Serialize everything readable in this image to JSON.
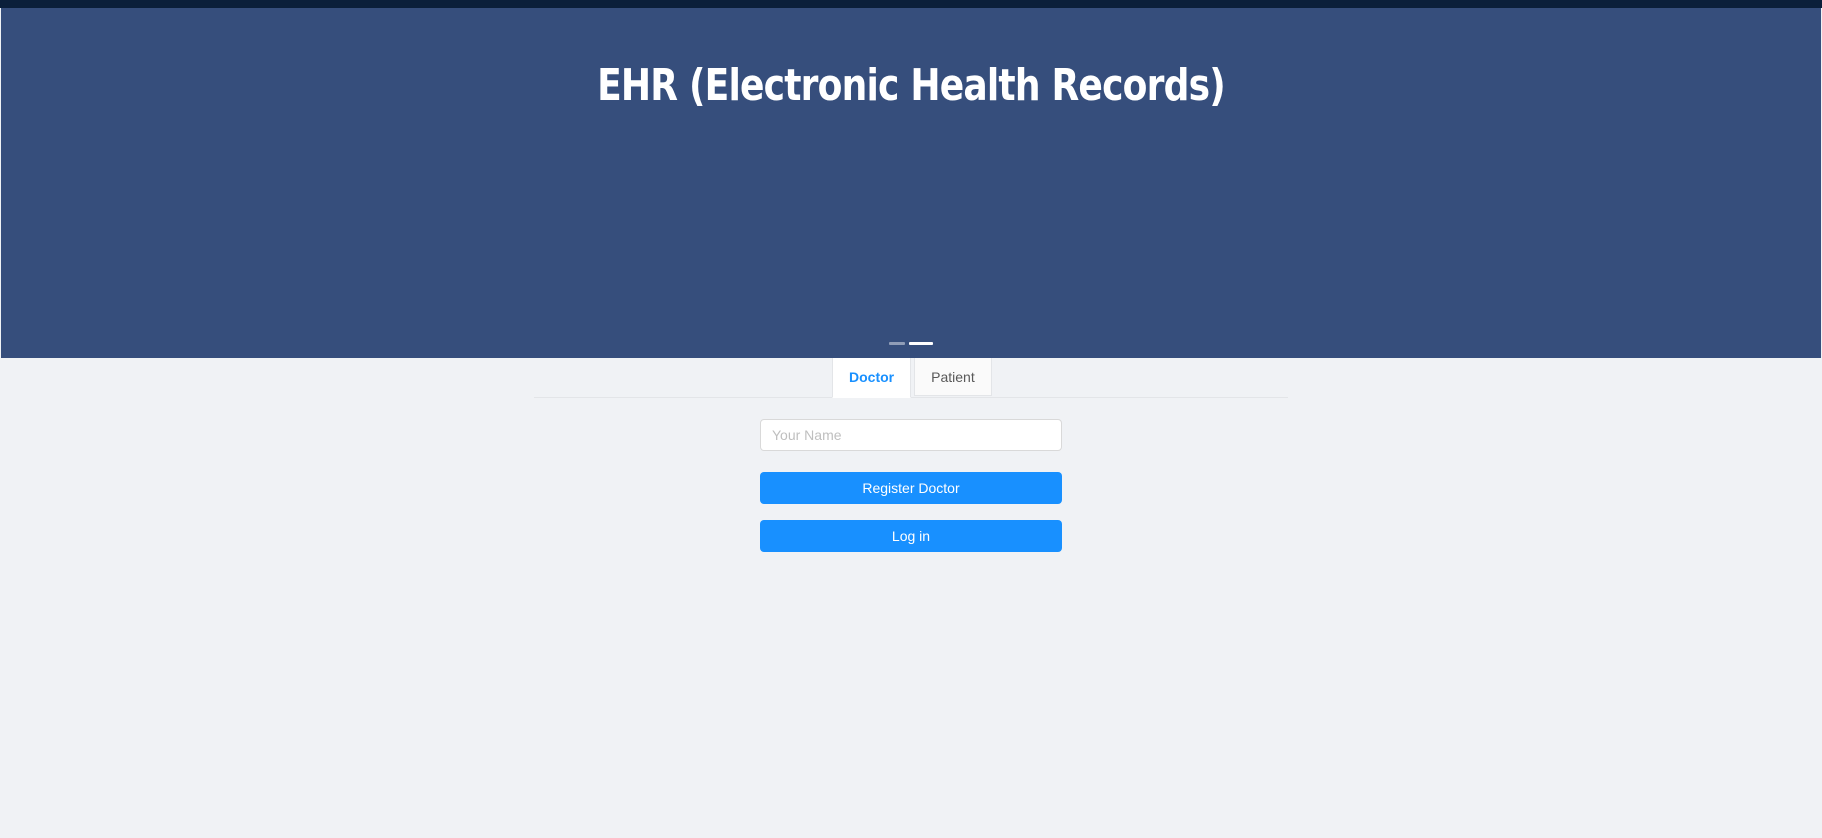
{
  "header": {
    "title": "EHR (Electronic Health Records)"
  },
  "carousel": {
    "slide_count": 2,
    "active_index": 1
  },
  "tabs": [
    {
      "label": "Doctor",
      "active": true
    },
    {
      "label": "Patient",
      "active": false
    }
  ],
  "form": {
    "name_value": "",
    "name_placeholder": "Your Name",
    "register_label": "Register Doctor",
    "login_label": "Log in"
  },
  "colors": {
    "banner": "#364e7c",
    "primary": "#1890ff",
    "page_background": "#f0f2f5"
  }
}
